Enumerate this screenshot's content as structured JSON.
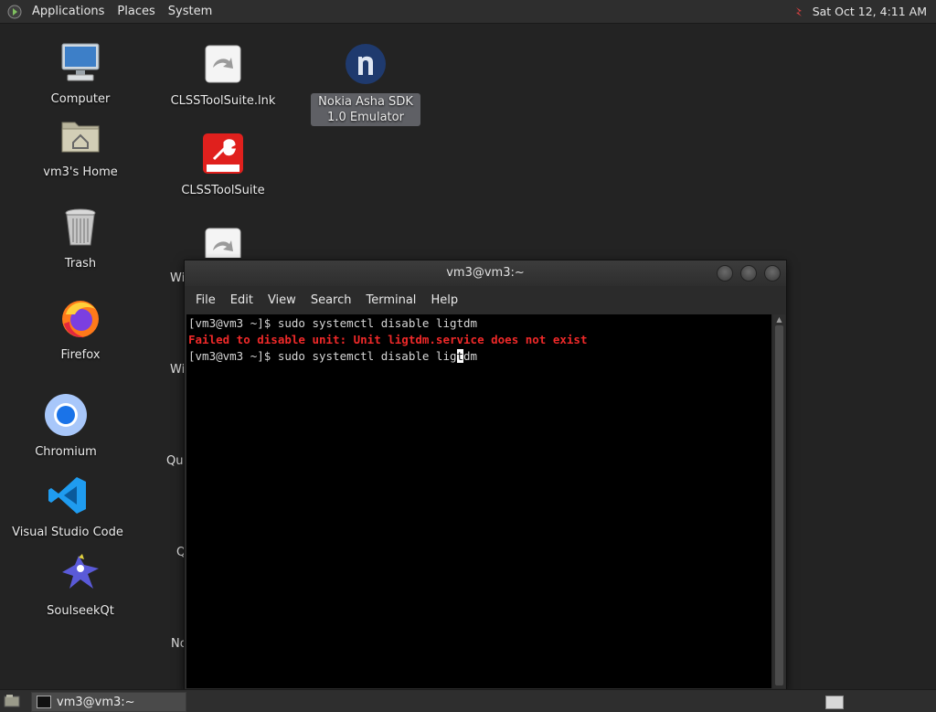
{
  "top_panel": {
    "menus": [
      "Applications",
      "Places",
      "System"
    ],
    "clock": "Sat Oct 12,  4:11 AM"
  },
  "desktop": {
    "icons": [
      {
        "label": "Computer",
        "icon": "computer-icon"
      },
      {
        "label": "vm3's Home",
        "icon": "home-folder-icon"
      },
      {
        "label": "Trash",
        "icon": "trash-icon"
      },
      {
        "label": "Firefox",
        "icon": "firefox-icon"
      },
      {
        "label": "Chromium",
        "icon": "chromium-icon"
      },
      {
        "label": "Visual Studio Code",
        "icon": "vscode-icon"
      },
      {
        "label": "SoulseekQt",
        "icon": "soulseek-icon"
      },
      {
        "label": "CLSSToolSuite.lnk",
        "icon": "link-icon"
      },
      {
        "label": "CLSSToolSuite",
        "icon": "honeywell-icon"
      },
      {
        "label": "Nokia Asha SDK 1.0 Emulator",
        "icon": "nokia-icon"
      }
    ],
    "clipped_labels": [
      "Wi",
      "Wi",
      "Qui",
      "Q",
      "No"
    ]
  },
  "terminal": {
    "title": "vm3@vm3:~",
    "menu": [
      "File",
      "Edit",
      "View",
      "Search",
      "Terminal",
      "Help"
    ],
    "lines": {
      "line1": "[vm3@vm3 ~]$ sudo systemctl disable ligtdm",
      "line2": "Failed to disable unit: Unit ligtdm.service does not exist",
      "line3_before": "[vm3@vm3 ~]$ sudo systemctl disable lig",
      "line3_cursor": "t",
      "line3_after": "dm"
    }
  },
  "taskbar": {
    "task_label": "vm3@vm3:~"
  },
  "colors": {
    "desktop_bg": "#232323",
    "error_text": "#ef2929",
    "terminal_bg": "#000000"
  }
}
